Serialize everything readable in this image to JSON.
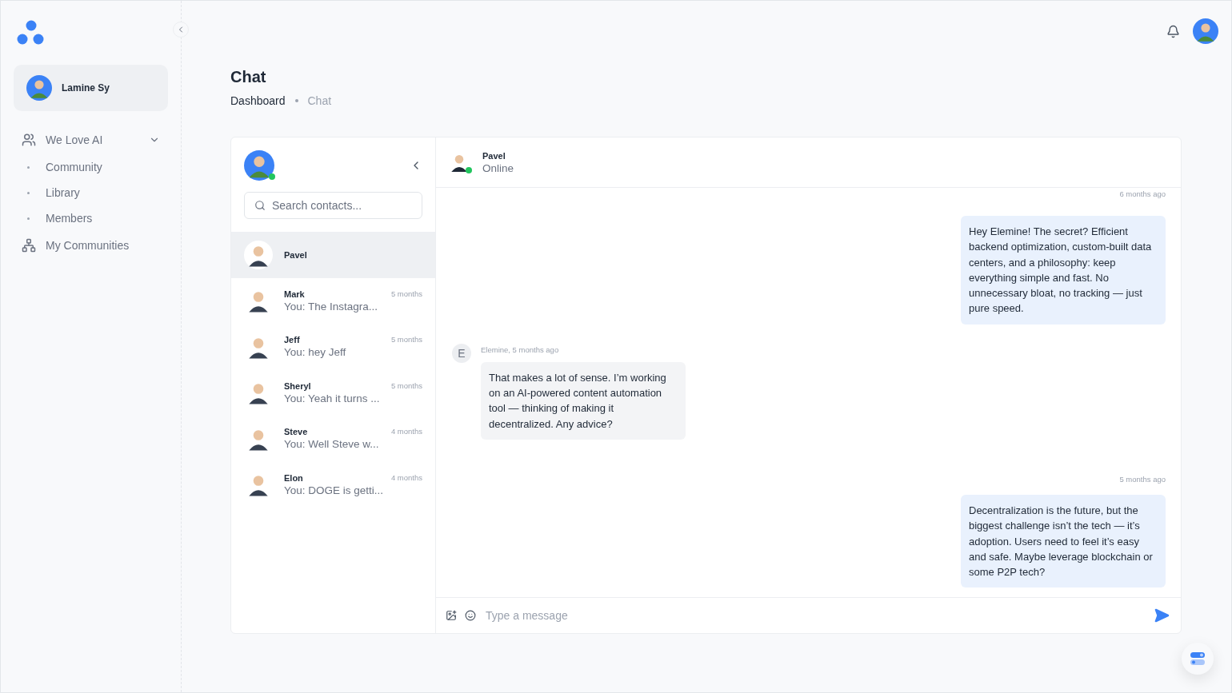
{
  "sidebar": {
    "user": {
      "name": "Lamine Sy"
    },
    "groups": [
      {
        "label": "We Love AI",
        "kind": "group",
        "expanded": true,
        "children": [
          {
            "label": "Community"
          },
          {
            "label": "Library"
          },
          {
            "label": "Members"
          }
        ]
      },
      {
        "label": "My Communities",
        "kind": "communities"
      }
    ]
  },
  "page": {
    "title": "Chat",
    "breadcrumbs": [
      "Dashboard",
      "Chat"
    ]
  },
  "contacts_panel": {
    "me": {
      "online": true
    },
    "search": {
      "placeholder": "Search contacts..."
    },
    "contacts": [
      {
        "name": "Pavel",
        "selected": true
      },
      {
        "name": "Mark",
        "preview": "You: The Instagra...",
        "time": "5 months",
        "selected": false
      },
      {
        "name": "Jeff",
        "preview": "You: hey Jeff",
        "time": "5 months",
        "selected": false
      },
      {
        "name": "Sheryl",
        "preview": "You: Yeah it turns ...",
        "time": "5 months",
        "selected": false
      },
      {
        "name": "Steve",
        "preview": "You: Well Steve w...",
        "time": "4 months",
        "selected": false
      },
      {
        "name": "Elon",
        "preview": "You: DOGE is getti...",
        "time": "4 months",
        "selected": false
      }
    ]
  },
  "conversation": {
    "contact": {
      "name": "Pavel",
      "status": "Online",
      "online": true
    },
    "messages": [
      {
        "kind": "outgoing",
        "time": "6 months ago",
        "text": "Hey Elemine! The secret? Efficient backend optimization, custom-built data centers, and a philosophy: keep everything simple and fast. No unnecessary bloat, no tracking — just pure speed."
      },
      {
        "kind": "incoming",
        "initial": "E",
        "sender": "Elemine,",
        "time": "5 months ago",
        "text": "That makes a lot of sense. I’m working on an AI-powered content automation tool — thinking of making it decentralized. Any advice?"
      },
      {
        "kind": "outgoing",
        "time": "5 months ago",
        "text": "Decentralization is the future, but the biggest challenge isn’t the tech — it’s adoption. Users need to feel it’s easy and safe. Maybe leverage blockchain or some P2P tech?"
      }
    ],
    "composer": {
      "placeholder": "Type a message"
    }
  }
}
